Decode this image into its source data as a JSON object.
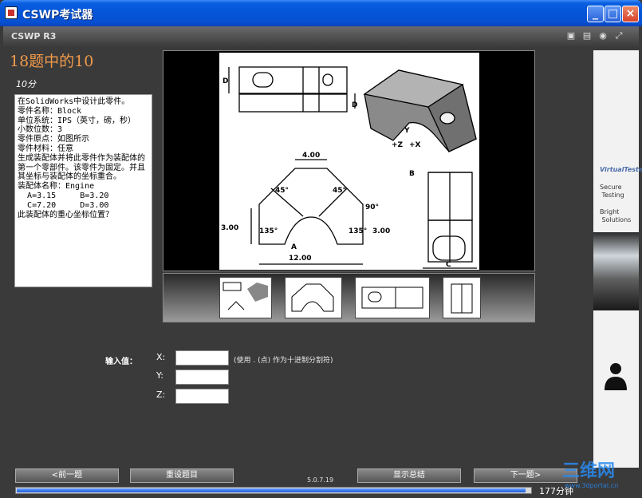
{
  "window": {
    "title": "CSWP考试器",
    "buttons": {
      "minimize": "_",
      "maximize": "□",
      "close": "×"
    }
  },
  "header": {
    "product": "CSWP R3",
    "icons": [
      "print-icon",
      "save-icon",
      "info-icon",
      "fullscreen-icon"
    ]
  },
  "question": {
    "title": "18题中的10",
    "points": "10分",
    "text": "在SolidWorks中设计此零件。\n零件名称：Block\n单位系统：IPS（英寸，磅，秒）\n小数位数：3\n零件原点：如图所示\n零件材料：任意\n生成装配体并将此零件作为装配体的第一个零部件。该零件为固定。并且其坐标与装配体的坐标重合。\n装配体名称：Engine\n  A=3.15     B=3.20\n  C=7.20     D=3.00\n此装配体的重心坐标位置？"
  },
  "drawing": {
    "dim_top": "4.00",
    "angle_left": "45°",
    "angle_right": "45°",
    "angle_90": "90°",
    "angle_135_left": "135°",
    "angle_135_right": "135°",
    "dim_left": "3.00",
    "dim_right": "3.00",
    "dim_bottom": "12.00",
    "label_a": "A",
    "label_b": "B",
    "label_c": "C",
    "label_d": "D",
    "label_d2": "D",
    "axis_y": "Y",
    "axis_z": "+Z",
    "axis_x": "+X"
  },
  "input": {
    "label": "输入值：",
    "x_label": "X:",
    "y_label": "Y:",
    "z_label": "Z:",
    "x_value": "",
    "y_value": "",
    "z_value": "",
    "hint": "(使用 . (点) 作为十进制分割符)"
  },
  "sidebar": {
    "logo": "VirtualTester",
    "secure": "Secure\n Testing",
    "bright": "Bright\n Solutions"
  },
  "nav": {
    "prev": "<前一题",
    "reset": "重设题目",
    "summary": "显示总结",
    "next": "下一题>"
  },
  "version": "5.0.7.19",
  "progress": {
    "fraction": 0.99
  },
  "time_left": "177分钟",
  "watermark": {
    "main": "三维网",
    "sub": "www.3dportal.cn"
  }
}
